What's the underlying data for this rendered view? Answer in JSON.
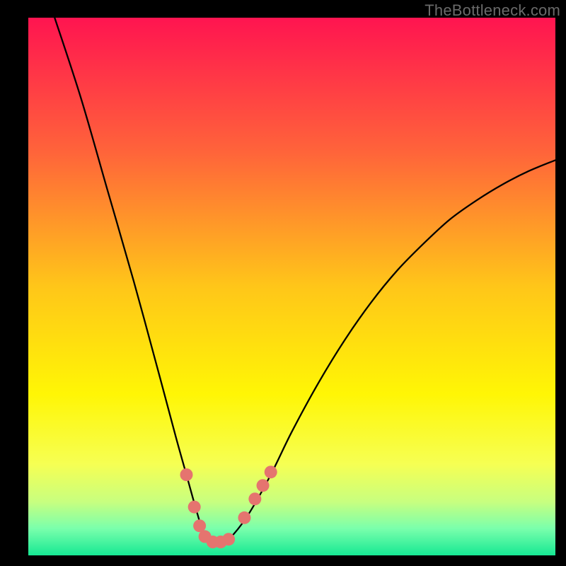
{
  "watermark": "TheBottleneck.com",
  "chart_data": {
    "type": "line",
    "title": "",
    "xlabel": "",
    "ylabel": "",
    "xlim": [
      0,
      100
    ],
    "ylim": [
      0,
      100
    ],
    "background_gradient": {
      "stops": [
        {
          "offset": 0.0,
          "color": "#ff1450"
        },
        {
          "offset": 0.25,
          "color": "#ff643a"
        },
        {
          "offset": 0.5,
          "color": "#ffc619"
        },
        {
          "offset": 0.7,
          "color": "#fff605"
        },
        {
          "offset": 0.83,
          "color": "#f6ff53"
        },
        {
          "offset": 0.9,
          "color": "#c8ff7f"
        },
        {
          "offset": 0.95,
          "color": "#7affac"
        },
        {
          "offset": 1.0,
          "color": "#16e893"
        }
      ]
    },
    "series": [
      {
        "name": "bottleneck-curve",
        "color": "#000000",
        "x": [
          5,
          10,
          15,
          20,
          25,
          28,
          30,
          32,
          33.5,
          35,
          37,
          39,
          42,
          46,
          50,
          55,
          60,
          65,
          70,
          75,
          80,
          85,
          90,
          95,
          100
        ],
        "y": [
          100,
          85,
          68,
          51,
          33,
          22,
          15,
          8,
          3.5,
          2.5,
          2.5,
          4,
          8,
          15,
          23,
          32,
          40,
          47,
          53,
          58,
          62.5,
          66,
          69,
          71.5,
          73.5
        ]
      }
    ],
    "markers": {
      "name": "highlight-points",
      "color": "#e5746f",
      "radius": 9,
      "points": [
        {
          "x": 30.0,
          "y": 15.0
        },
        {
          "x": 31.5,
          "y": 9.0
        },
        {
          "x": 32.5,
          "y": 5.5
        },
        {
          "x": 33.5,
          "y": 3.5
        },
        {
          "x": 35.0,
          "y": 2.5
        },
        {
          "x": 36.5,
          "y": 2.5
        },
        {
          "x": 38.0,
          "y": 3.0
        },
        {
          "x": 41.0,
          "y": 7.0
        },
        {
          "x": 43.0,
          "y": 10.5
        },
        {
          "x": 44.5,
          "y": 13.0
        },
        {
          "x": 46.0,
          "y": 15.5
        }
      ]
    }
  }
}
